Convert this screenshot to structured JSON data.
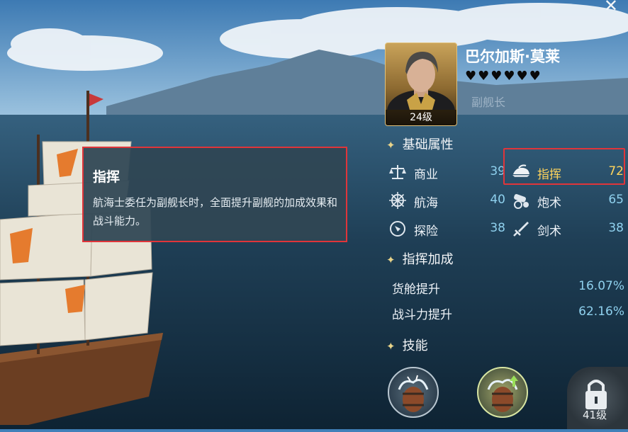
{
  "officer": {
    "name": "巴尔加斯·莫莱",
    "hearts": "♥♥♥♥♥♥",
    "level": "24级",
    "role": "副舰长"
  },
  "basic_attributes": {
    "title": "基础属性",
    "items": [
      {
        "label": "商业",
        "value": "39",
        "icon": "scales-icon"
      },
      {
        "label": "指挥",
        "value": "72",
        "icon": "command-helmet-icon",
        "highlighted": true
      },
      {
        "label": "航海",
        "value": "40",
        "icon": "ship-wheel-icon"
      },
      {
        "label": "炮术",
        "value": "65",
        "icon": "cannon-icon"
      },
      {
        "label": "探险",
        "value": "38",
        "icon": "compass-icon"
      },
      {
        "label": "剑术",
        "value": "38",
        "icon": "sword-icon"
      }
    ]
  },
  "command_bonus": {
    "title": "指挥加成",
    "rows": [
      {
        "label": "货舱提升",
        "value": "16.07%"
      },
      {
        "label": "战斗力提升",
        "value": "62.16%"
      }
    ]
  },
  "skills": {
    "title": "技能",
    "locked_level": "41级"
  },
  "tooltip": {
    "title": "指挥",
    "body": "航海士委任为副舰长时，全面提升副舰的加成效果和战斗能力。"
  },
  "colors": {
    "highlight": "#ffd45c",
    "value": "#8fd1ee",
    "annotation": "#e0353a"
  }
}
